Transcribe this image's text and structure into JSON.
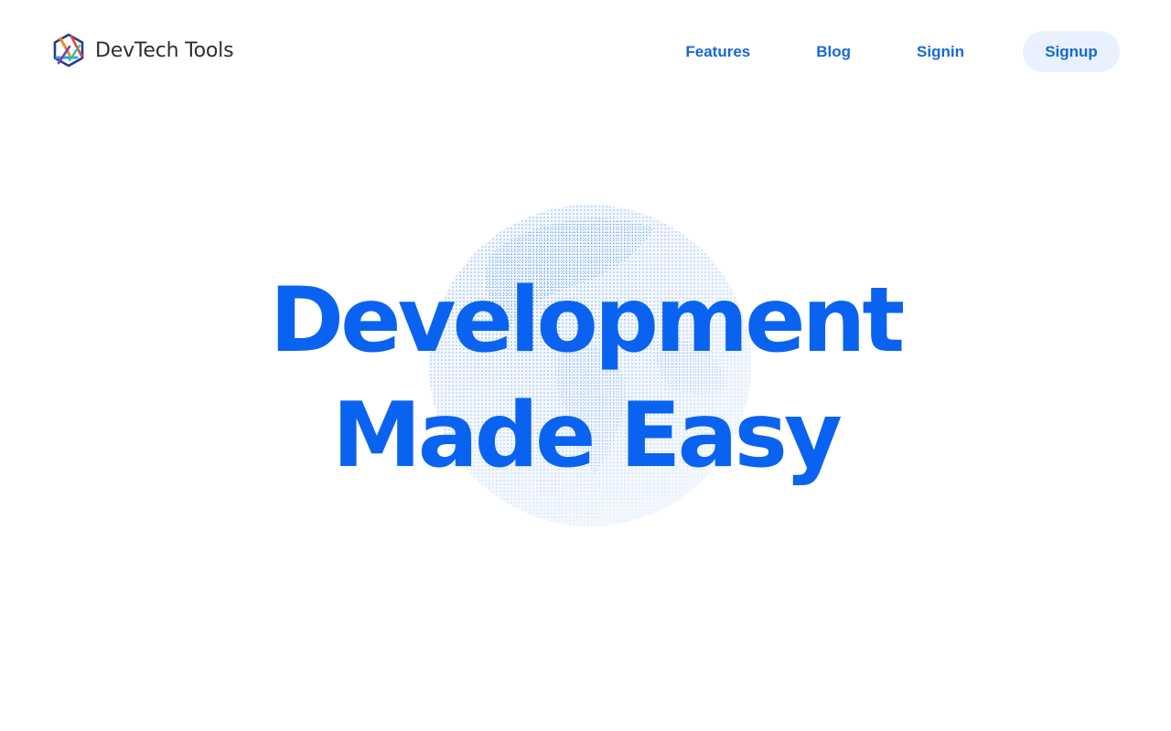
{
  "brand": {
    "name": "DevTech Tools",
    "logo_icon": "hexagon-triangle-logo-icon"
  },
  "nav": {
    "items": [
      {
        "label": "Features"
      },
      {
        "label": "Blog"
      },
      {
        "label": "Signin"
      }
    ],
    "signup_label": "Signup"
  },
  "hero": {
    "line1": "Development",
    "line2": "Made Easy",
    "background_icon": "dotted-globe-icon"
  },
  "colors": {
    "accent": "#0a63f0",
    "nav_text": "#1669d6",
    "signup_bg": "#e8f1fd",
    "brand_text": "#2b2f36",
    "globe_dots": "#3d8df2"
  }
}
